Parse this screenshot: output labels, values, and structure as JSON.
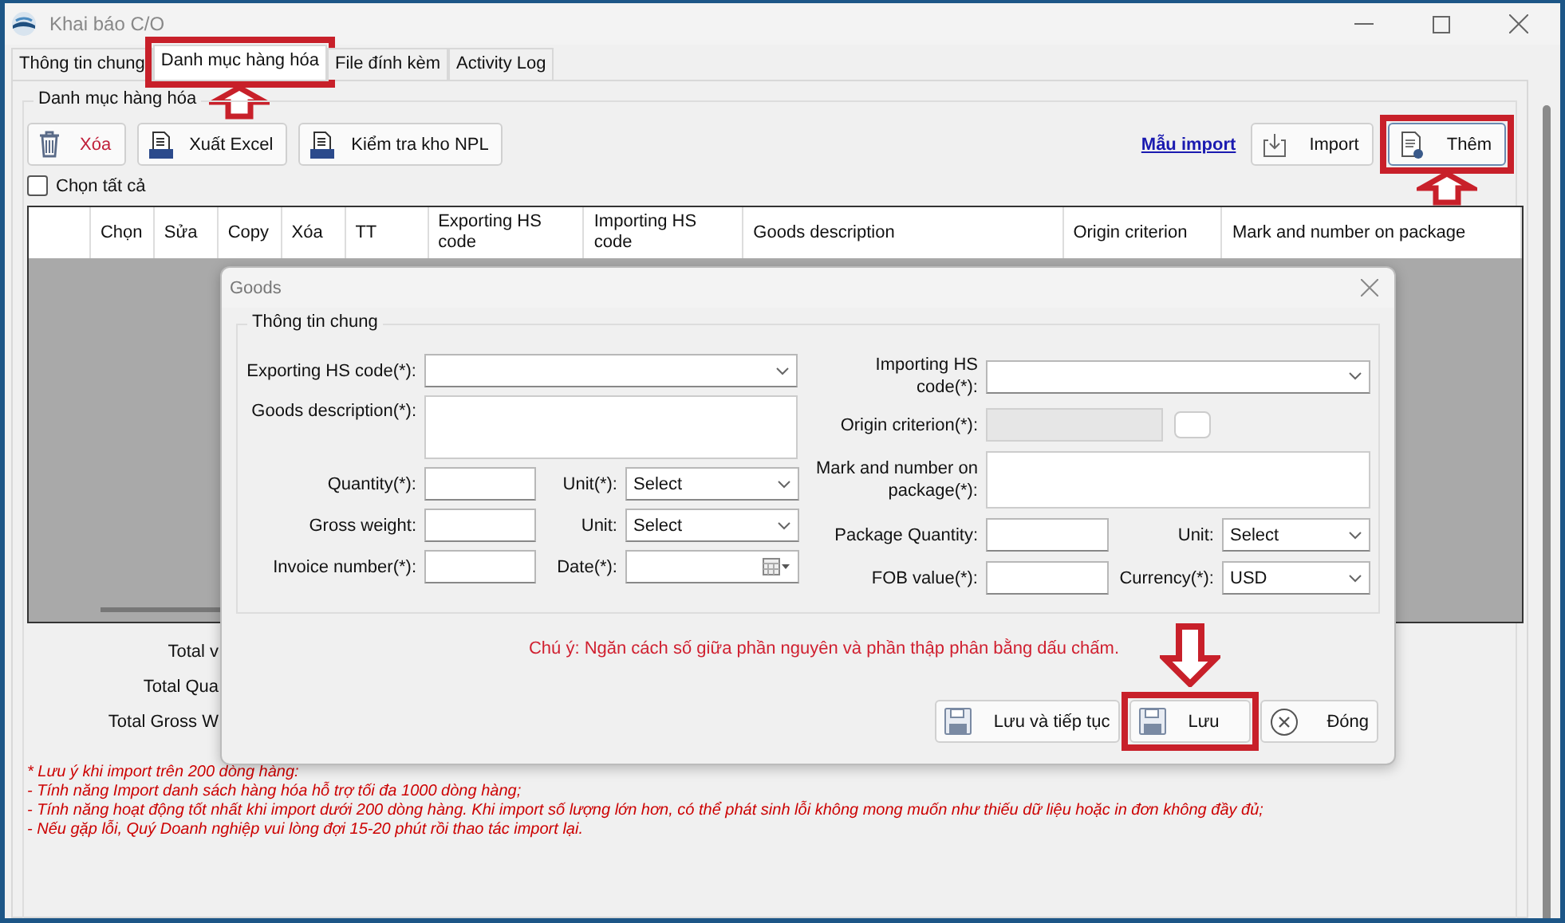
{
  "window": {
    "title": "Khai báo C/O"
  },
  "tabs": [
    {
      "label": "Thông tin chung",
      "selected": false,
      "highlighted": false
    },
    {
      "label": "Danh mục hàng hóa",
      "selected": true,
      "highlighted": true
    },
    {
      "label": "File đính kèm",
      "selected": false,
      "highlighted": false
    },
    {
      "label": "Activity Log",
      "selected": false,
      "highlighted": false
    }
  ],
  "group_title": "Danh mục hàng hóa",
  "toolbar_left": [
    {
      "label": "Xóa",
      "kind": "delete"
    },
    {
      "label": "Xuất Excel",
      "kind": "document"
    },
    {
      "label": "Kiểm tra kho NPL",
      "kind": "document"
    }
  ],
  "import_template_link": "Mẫu import",
  "toolbar_right": [
    {
      "label": "Import",
      "kind": "import",
      "highlighted": false
    },
    {
      "label": "Thêm",
      "kind": "add",
      "highlighted": true
    }
  ],
  "select_all": {
    "label": "Chọn tất cả",
    "checked": false
  },
  "table": {
    "columns": [
      "",
      "Chọn",
      "Sửa",
      "Copy",
      "Xóa",
      "TT",
      "Exporting HS code",
      "Importing HS code",
      "Goods description",
      "Origin criterion",
      "Mark and number on package"
    ]
  },
  "totals": [
    "Total v",
    "Total Qua",
    "Total Gross W"
  ],
  "notes": [
    "* Lưu ý khi import trên 200 dòng hàng:",
    "- Tính năng Import danh sách hàng hóa hỗ trợ tối đa 1000 dòng hàng;",
    "- Tính năng hoạt động tốt nhất khi import dưới 200 dòng hàng. Khi import số lượng lớn hơn, có thể phát sinh lỗi không mong muốn như thiếu dữ liệu hoặc in đơn không đầy đủ;",
    "- Nếu gặp lỗi, Quý Doanh nghiệp vui lòng đợi 15-20 phút rồi thao tác import lại."
  ],
  "dialog": {
    "title": "Goods",
    "group_title": "Thông tin chung",
    "left_rows": [
      {
        "label": "Exporting HS code(*):",
        "field": {
          "kind": "combo"
        }
      },
      {
        "label": "Goods description(*):",
        "field": {
          "kind": "textarea"
        }
      },
      {
        "label": "Quantity(*):",
        "field": {
          "kind": "text"
        },
        "extra": {
          "label": "Unit(*):",
          "field": {
            "kind": "combo",
            "value": "Select"
          }
        }
      },
      {
        "label": "Gross weight:",
        "field": {
          "kind": "text"
        },
        "extra": {
          "label": "Unit:",
          "field": {
            "kind": "combo",
            "value": "Select"
          }
        }
      },
      {
        "label": "Invoice number(*):",
        "field": {
          "kind": "text"
        },
        "extra": {
          "label": "Date(*):",
          "field": {
            "kind": "date"
          }
        }
      }
    ],
    "right_rows": [
      {
        "label": "Importing HS code(*):",
        "field": {
          "kind": "combo"
        }
      },
      {
        "label": "Origin criterion(*):",
        "field": {
          "kind": "picker",
          "disabled": true
        }
      },
      {
        "label": "Mark and number on package(*):",
        "field": {
          "kind": "textarea"
        }
      },
      {
        "label": "Package Quantity:",
        "field": {
          "kind": "text"
        },
        "extra": {
          "label": "Unit:",
          "field": {
            "kind": "combo",
            "value": "Select"
          }
        }
      },
      {
        "label": "FOB value(*):",
        "field": {
          "kind": "text"
        },
        "extra": {
          "label": "Currency(*):",
          "field": {
            "kind": "combo",
            "value": "USD"
          }
        }
      }
    ],
    "note": "Chú ý: Ngăn cách số giữa phần nguyên và phần thập phân bằng dấu chấm.",
    "buttons": [
      {
        "label": "Lưu và tiếp tục",
        "kind": "save",
        "highlighted": false
      },
      {
        "label": "Lưu",
        "kind": "save",
        "highlighted": true
      },
      {
        "label": "Đóng",
        "kind": "close",
        "highlighted": false
      }
    ]
  }
}
